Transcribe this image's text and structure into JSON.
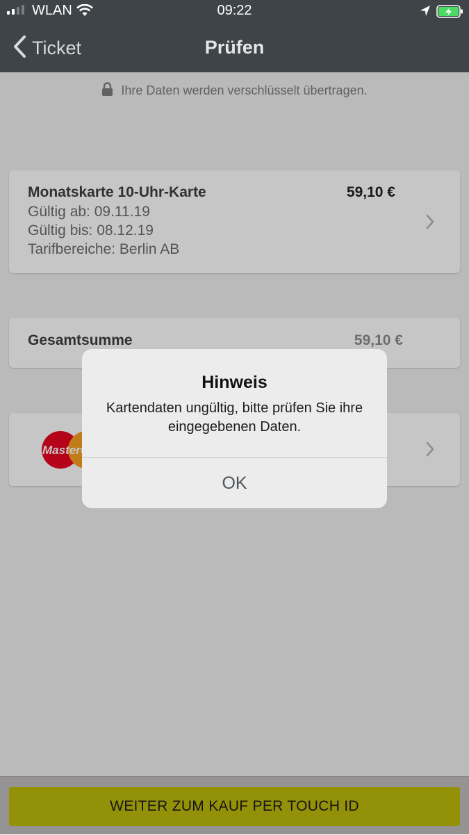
{
  "status_bar": {
    "carrier": "WLAN",
    "time": "09:22",
    "icons": [
      "signal-icon",
      "wifi-icon",
      "location-arrow-icon",
      "battery-charging-icon"
    ]
  },
  "nav": {
    "back_label": "Ticket",
    "title": "Prüfen"
  },
  "secure_notice": "Ihre Daten werden verschlüsselt übertragen.",
  "ticket": {
    "name": "Monatskarte 10-Uhr-Karte",
    "price": "59,10 €",
    "valid_from": "Gültig ab: 09.11.19",
    "valid_to": "Gültig bis: 08.12.19",
    "zones": "Tarifbereiche: Berlin AB"
  },
  "total": {
    "label": "Gesamtsumme",
    "value": "59,10 €"
  },
  "payment": {
    "method_logo": "MasterCard",
    "logo_text": "MasterC"
  },
  "buy_button": "WEITER ZUM KAUF PER TOUCH ID",
  "alert": {
    "title": "Hinweis",
    "message": "Kartendaten ungültig, bitte prüfen Sie ihre eingegebenen Daten.",
    "ok_label": "OK"
  },
  "colors": {
    "nav_bar": "#3e4448",
    "accent_button": "#f0f000",
    "battery_green": "#4cd964"
  }
}
